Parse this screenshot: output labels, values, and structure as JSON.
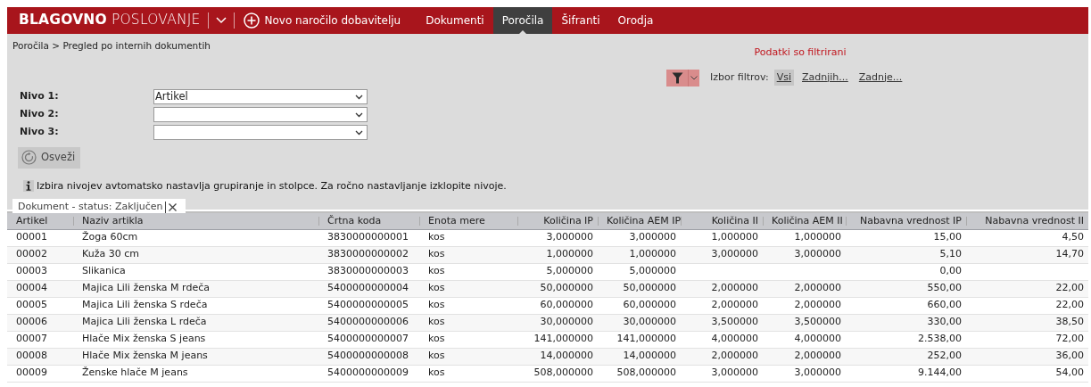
{
  "app": {
    "title_bold": "BLAGOVNO",
    "title_light": "POSLOVANJE",
    "new_order": "Novo naročilo dobavitelju"
  },
  "nav": [
    {
      "label": "Dokumenti",
      "selected": false
    },
    {
      "label": "Poročila",
      "selected": true
    },
    {
      "label": "Šifranti",
      "selected": false
    },
    {
      "label": "Orodja",
      "selected": false
    }
  ],
  "breadcrumb": "Poročila > Pregled po internih dokumentih",
  "filter_notice": "Podatki so filtrirani",
  "filter_bar": {
    "active": true,
    "label": "Izbor filtrov:",
    "options": [
      {
        "label": "Vsi",
        "selected": true
      },
      {
        "label": "Zadnjih...",
        "selected": false
      },
      {
        "label": "Zadnje...",
        "selected": false
      }
    ]
  },
  "levels": [
    {
      "label": "Nivo 1:",
      "value": "Artikel"
    },
    {
      "label": "Nivo 2:"
    },
    {
      "label": "Nivo 3:"
    }
  ],
  "refresh_button": "Osveži",
  "info": "Izbira nivojev avtomatsko nastavlja grupiranje in stolpce. Za ročno nastavljanje izklopite nivoje.",
  "filter_chip": "Dokument - status: Zaključen",
  "table": {
    "columns": [
      {
        "label": "Artikel",
        "kind": "text"
      },
      {
        "label": "Naziv artikla",
        "kind": "text"
      },
      {
        "label": "Črtna koda",
        "kind": "text"
      },
      {
        "label": "Enota mere",
        "kind": "text"
      },
      {
        "label": "Količina IP",
        "kind": "number"
      },
      {
        "label": "Količina AEM IP",
        "kind": "number"
      },
      {
        "label": "Količina II",
        "kind": "number"
      },
      {
        "label": "Količina AEM II",
        "kind": "number"
      },
      {
        "label": "Nabavna vrednost IP",
        "kind": "number"
      },
      {
        "label": "Nabavna vrednost II",
        "kind": "number"
      }
    ],
    "rows": [
      [
        "00001",
        "Žoga 60cm",
        "3830000000001",
        "kos",
        "3,000000",
        "3,000000",
        "1,000000",
        "1,000000",
        "15,00",
        "4,50"
      ],
      [
        "00002",
        "Kuža 30 cm",
        "3830000000002",
        "kos",
        "1,000000",
        "1,000000",
        "3,000000",
        "3,000000",
        "5,10",
        "14,70"
      ],
      [
        "00003",
        "Slikanica",
        "3830000000003",
        "kos",
        "5,000000",
        "5,000000",
        null,
        null,
        "0,00",
        null
      ],
      [
        "00004",
        "Majica Lili ženska M rdeča",
        "5400000000004",
        "kos",
        "50,000000",
        "50,000000",
        "2,000000",
        "2,000000",
        "550,00",
        "22,00"
      ],
      [
        "00005",
        "Majica Lili ženska S rdeča",
        "5400000000005",
        "kos",
        "60,000000",
        "60,000000",
        "2,000000",
        "2,000000",
        "660,00",
        "22,00"
      ],
      [
        "00006",
        "Majica Lili ženska L rdeča",
        "5400000000006",
        "kos",
        "30,000000",
        "30,000000",
        "3,500000",
        "3,500000",
        "330,00",
        "38,50"
      ],
      [
        "00007",
        "Hlače Mix ženska S jeans",
        "5400000000007",
        "kos",
        "141,000000",
        "141,000000",
        "4,000000",
        "4,000000",
        "2.538,00",
        "72,00"
      ],
      [
        "00008",
        "Hlače Mix ženska M jeans",
        "5400000000008",
        "kos",
        "14,000000",
        "14,000000",
        "2,000000",
        "2,000000",
        "252,00",
        "36,00"
      ],
      [
        "00009",
        "Ženske hlače M jeans",
        "5400000000009",
        "kos",
        "508,000000",
        "508,000000",
        "3,000000",
        "3,000000",
        "9.144,00",
        "54,00"
      ]
    ]
  }
}
